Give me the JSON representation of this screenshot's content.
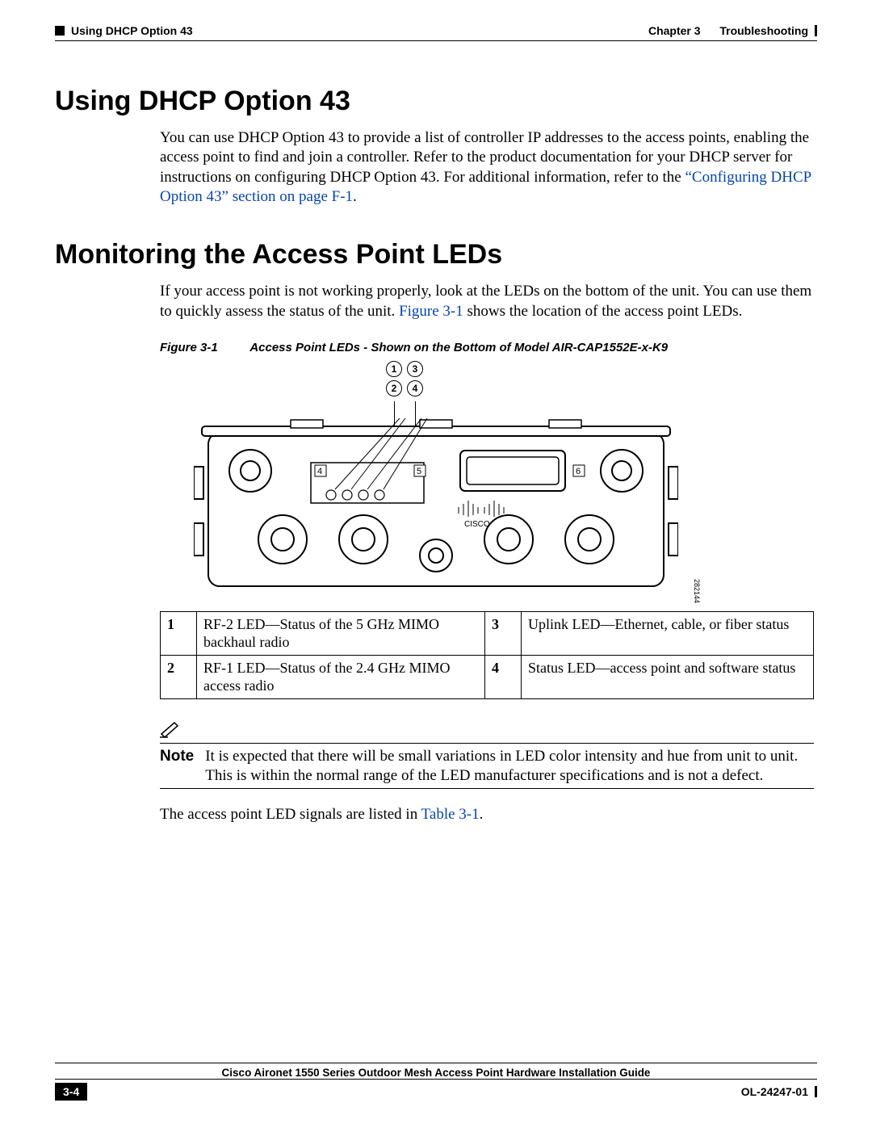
{
  "header": {
    "section": "Using DHCP Option 43",
    "chapter_label": "Chapter 3",
    "chapter_title": "Troubleshooting"
  },
  "sections": {
    "dhcp": {
      "title": "Using DHCP Option 43",
      "para_a": "You can use DHCP Option 43 to provide a list of controller IP addresses to the access points, enabling the access point to find and join a controller. Refer to the product documentation for your DHCP server for instructions on configuring DHCP Option 43. For additional information, refer to the ",
      "xref": "“Configuring DHCP Option 43” section on page F-1",
      "para_b": "."
    },
    "leds": {
      "title": "Monitoring the Access Point LEDs",
      "para_a": "If your access point is not working properly, look at the LEDs on the bottom of the unit. You can use them to quickly assess the status of the unit. ",
      "xref": "Figure 3-1",
      "para_b": " shows the location of the access point LEDs."
    }
  },
  "figure": {
    "num": "Figure 3-1",
    "caption": "Access Point LEDs - Shown on the Bottom of Model AIR-CAP1552E-x-K9",
    "callouts": [
      "1",
      "2",
      "3",
      "4"
    ],
    "internal_labels": [
      "4",
      "5",
      "6"
    ],
    "part_number": "282144"
  },
  "legend": [
    {
      "n": "1",
      "d": "RF-2 LED—Status of the 5 GHz MIMO backhaul radio",
      "n2": "3",
      "d2": "Uplink LED—Ethernet, cable, or fiber status"
    },
    {
      "n": "2",
      "d": "RF-1 LED—Status of the 2.4 GHz MIMO access radio",
      "n2": "4",
      "d2": "Status LED—access point and software status"
    }
  ],
  "note": {
    "label": "Note",
    "text": "It is expected that there will be small variations in LED color intensity and hue from unit to unit. This is within the normal range of the LED manufacturer specifications and is not a defect."
  },
  "after_note": {
    "a": "The access point LED signals are listed in ",
    "xref": "Table 3-1",
    "b": "."
  },
  "footer": {
    "guide": "Cisco Aironet 1550 Series Outdoor Mesh Access Point Hardware Installation Guide",
    "page": "3-4",
    "docnum": "OL-24247-01"
  }
}
